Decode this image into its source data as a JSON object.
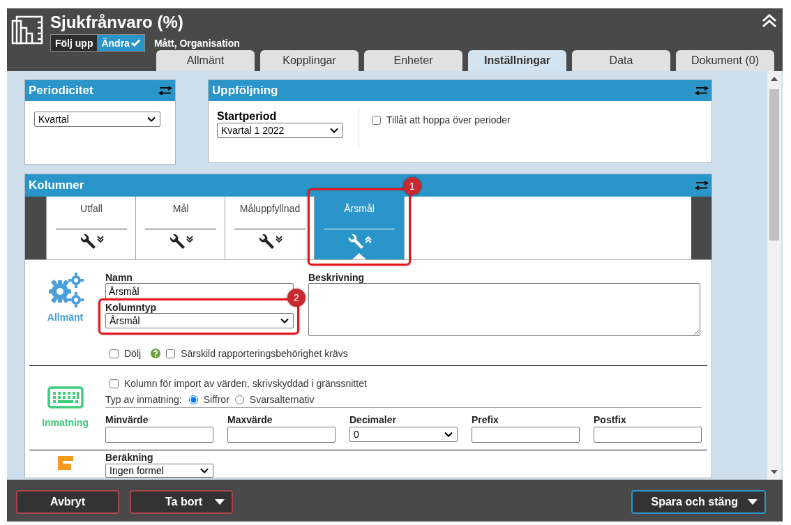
{
  "header": {
    "title": "Sjukfrånvaro (%)",
    "mode_toggle": [
      {
        "label": "Följ upp",
        "selected": false
      },
      {
        "label": "Ändra",
        "selected": true
      }
    ],
    "subtitle": "Mått, Organisation"
  },
  "tabs": [
    {
      "label": "Allmänt",
      "selected": false
    },
    {
      "label": "Kopplingar",
      "selected": false
    },
    {
      "label": "Enheter",
      "selected": false
    },
    {
      "label": "Inställningar",
      "selected": true
    },
    {
      "label": "Data",
      "selected": false
    },
    {
      "label": "Dokument (0)",
      "selected": false
    }
  ],
  "periodicitet": {
    "title": "Periodicitet",
    "select": "Kvartal"
  },
  "uppfoljning": {
    "title": "Uppföljning",
    "startperiod_label": "Startperiod",
    "startperiod": "Kvartal 1 2022",
    "skip_periods": {
      "label": "Tillåt att hoppa över perioder",
      "checked": false
    }
  },
  "kolumner": {
    "title": "Kolumner",
    "column_tabs": [
      {
        "label": "Utfall",
        "selected": false
      },
      {
        "label": "Mål",
        "selected": false
      },
      {
        "label": "Måluppfyllnad",
        "selected": false
      },
      {
        "label": "Årsmål",
        "selected": true,
        "callout": "1"
      }
    ],
    "allmant": {
      "section_label": "Allmänt",
      "name_label": "Namn",
      "name": "Årsmål",
      "type_label": "Kolumntyp",
      "type": "Årsmål",
      "type_callout": "2",
      "description_label": "Beskrivning",
      "checks": [
        {
          "label": "Dölj",
          "checked": false,
          "help": true
        },
        {
          "label": "Särskild rapporteringsbehörighet krävs",
          "checked": false,
          "help": false
        }
      ]
    },
    "inmatning": {
      "section_label": "Inmatning",
      "import_check": {
        "label": "Kolumn för import av värden, skrivskyddad i gränssnittet",
        "checked": false
      },
      "input_type_label": "Typ av inmatning:",
      "input_types": [
        {
          "label": "Siffror",
          "selected": true
        },
        {
          "label": "Svarsalternativ",
          "selected": false
        }
      ],
      "fields": [
        {
          "label": "Minvärde",
          "kind": "text"
        },
        {
          "label": "Maxvärde",
          "kind": "text"
        },
        {
          "label": "Decimaler",
          "kind": "select",
          "value": "0"
        },
        {
          "label": "Prefix",
          "kind": "text"
        },
        {
          "label": "Postfix",
          "kind": "text"
        }
      ]
    },
    "berakning": {
      "label": "Beräkning",
      "select": "Ingen formel"
    }
  },
  "footer": {
    "buttons": [
      {
        "label": "Avbryt",
        "kind": "danger",
        "dropdown": false
      },
      {
        "label": "Ta bort",
        "kind": "danger",
        "dropdown": true
      },
      {
        "label": "Spara och stäng",
        "kind": "primary",
        "dropdown": true
      }
    ]
  }
}
